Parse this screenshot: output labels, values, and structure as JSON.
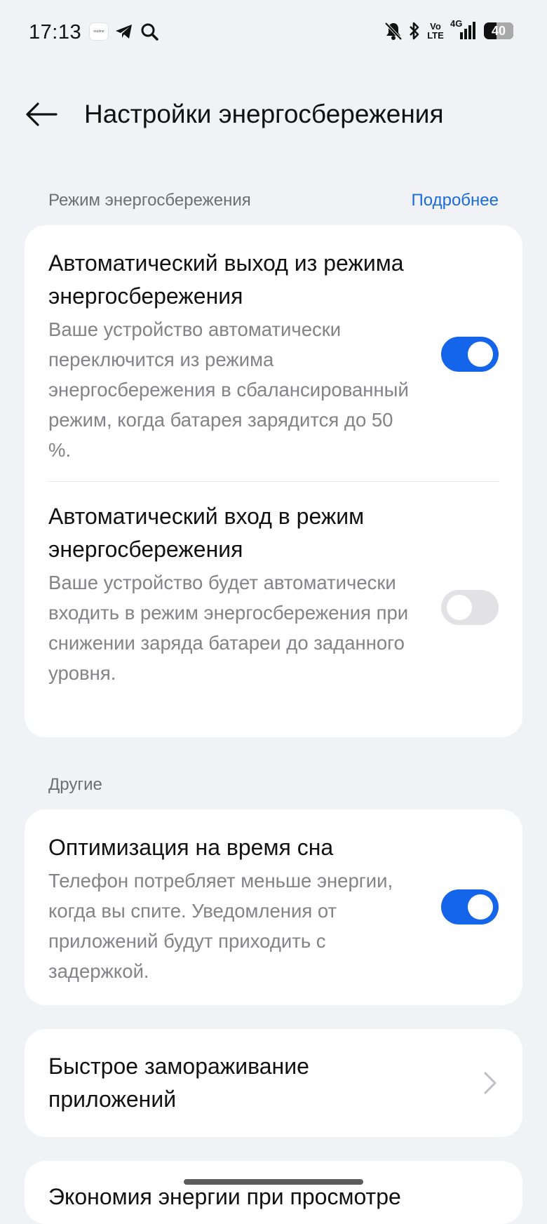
{
  "status_bar": {
    "time": "17:13",
    "app_badge": "realme",
    "network": "4G",
    "volte_top": "Vo",
    "volte_bottom": "LTE",
    "battery": "40"
  },
  "header": {
    "title": "Настройки энергосбережения"
  },
  "power_saving_section": {
    "title": "Режим энергосбережения",
    "more_link": "Подробнее",
    "items": [
      {
        "title": "Автоматический выход из режима энергосбережения",
        "description": "Ваше устройство автоматически переключится из режима энергосбережения в сбалансированный режим, когда батарея зарядится до 50 %.",
        "enabled": true
      },
      {
        "title": "Автоматический вход в режим энергосбережения",
        "description": "Ваше устройство будет автоматически входить в режим энергосбережения при снижении заряда батареи до заданного уровня.",
        "enabled": false
      }
    ]
  },
  "other_section": {
    "title": "Другие",
    "items": [
      {
        "title": "Оптимизация на время сна",
        "description": "Телефон потребляет меньше энергии, когда вы спите. Уведомления от приложений будут приходить с задержкой.",
        "enabled": true
      }
    ]
  },
  "quick_freeze": {
    "title": "Быстрое замораживание приложений"
  },
  "partial_item": {
    "title": "Экономия энергии при просмотре"
  },
  "colors": {
    "background": "#f1f2f5",
    "accent": "#1565ea",
    "link": "#1a6be0"
  }
}
